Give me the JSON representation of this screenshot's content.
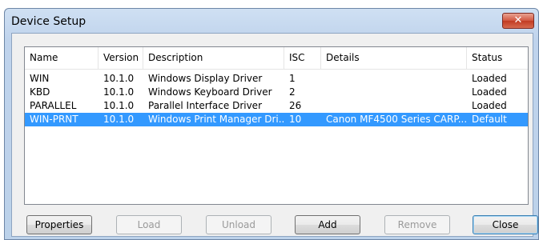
{
  "window": {
    "title": "Device Setup",
    "close_glyph": "✕"
  },
  "columns": [
    "Name",
    "Version",
    "Description",
    "ISC",
    "Details",
    "Status"
  ],
  "rows": [
    {
      "name": "WIN",
      "version": "10.1.0",
      "description": "Windows Display Driver",
      "isc": "1",
      "details": "",
      "status": "Loaded",
      "selected": false
    },
    {
      "name": "KBD",
      "version": "10.1.0",
      "description": "Windows Keyboard Driver",
      "isc": "2",
      "details": "",
      "status": "Loaded",
      "selected": false
    },
    {
      "name": "PARALLEL",
      "version": "10.1.0",
      "description": "Parallel Interface Driver",
      "isc": "26",
      "details": "",
      "status": "Loaded",
      "selected": false
    },
    {
      "name": "WIN-PRNT",
      "version": "10.1.0",
      "description": "Windows Print Manager Dri...",
      "isc": "10",
      "details": "Canon MF4500 Series CARP...",
      "status": "Default",
      "selected": true
    }
  ],
  "buttons": {
    "properties": "Properties",
    "load": "Load",
    "unload": "Unload",
    "add": "Add",
    "remove": "Remove",
    "close": "Close"
  },
  "colors": {
    "selection": "#3399ff",
    "titlebar": "#bfd3ec",
    "close_button": "#c23b22"
  }
}
